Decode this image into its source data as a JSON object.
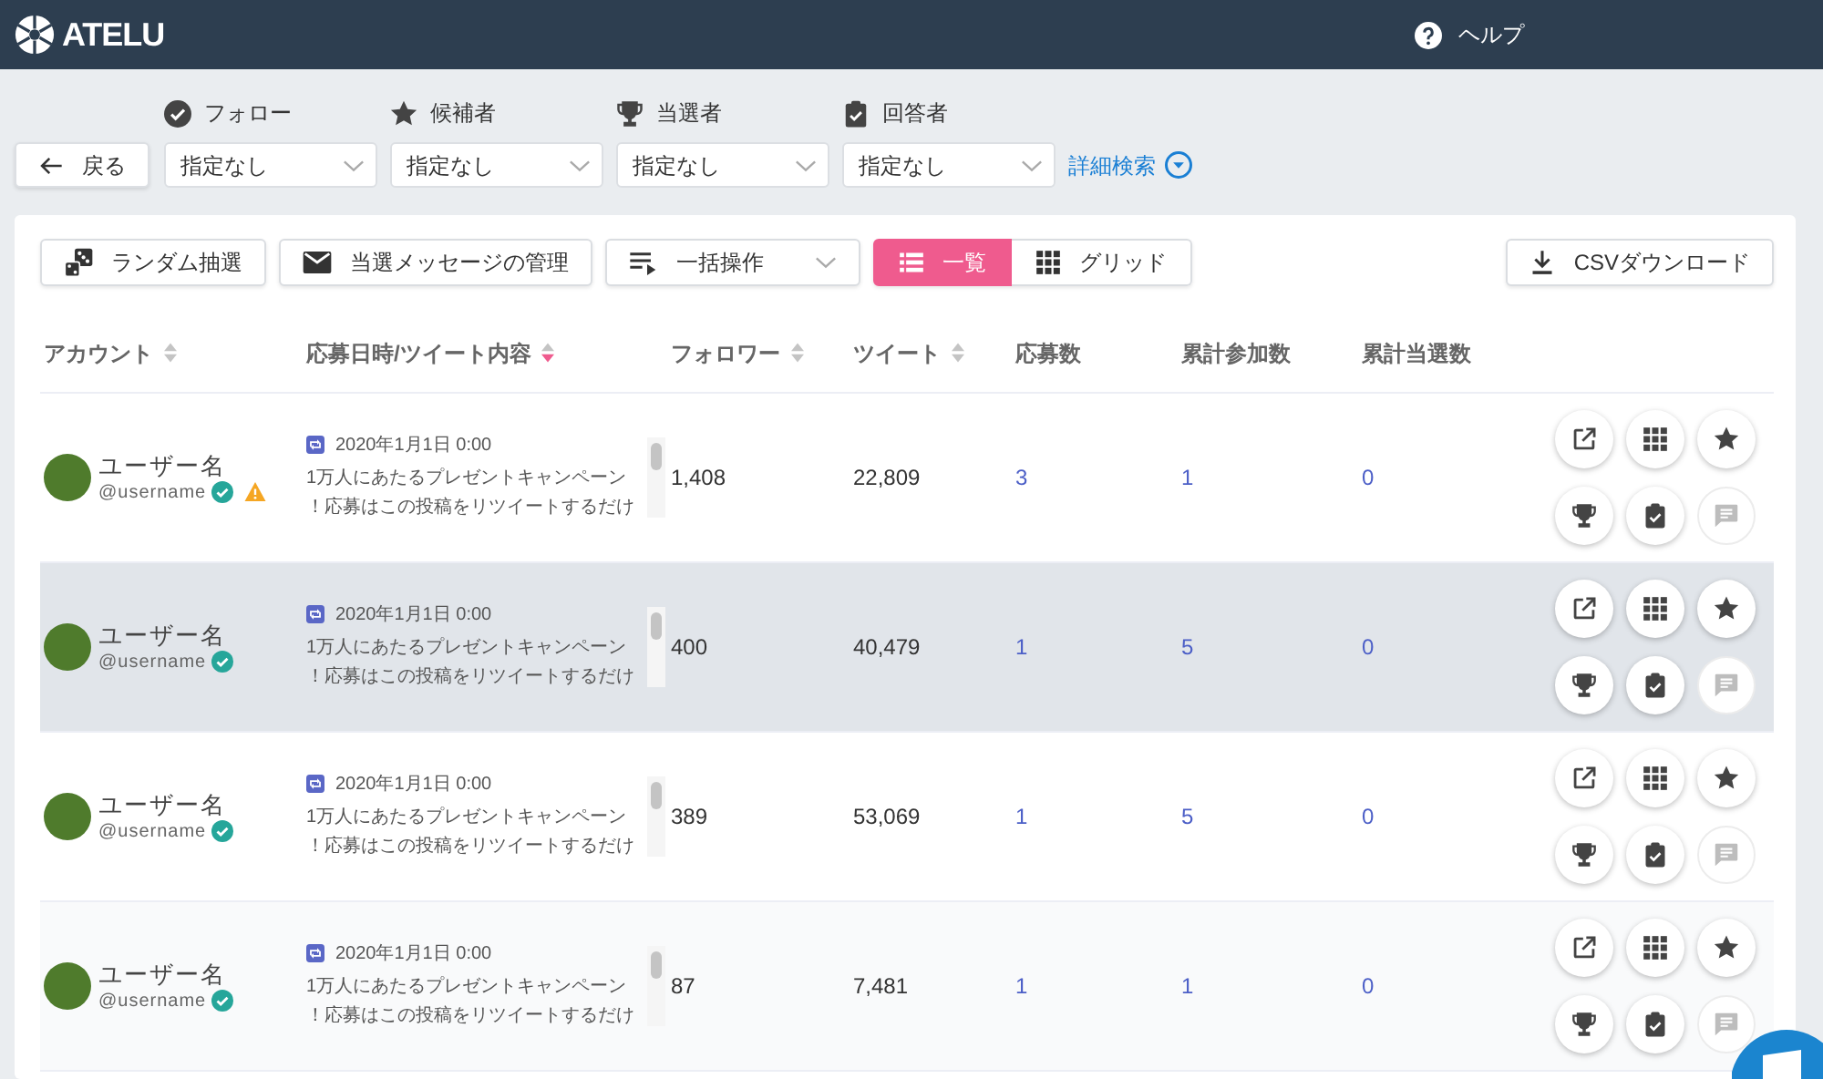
{
  "header": {
    "logo": "ATELU",
    "help": "ヘルプ"
  },
  "back_button": "戻る",
  "filters": [
    {
      "label": "フォロー",
      "value": "指定なし"
    },
    {
      "label": "候補者",
      "value": "指定なし"
    },
    {
      "label": "当選者",
      "value": "指定なし"
    },
    {
      "label": "回答者",
      "value": "指定なし"
    }
  ],
  "advanced_search": "詳細検索",
  "toolbar": {
    "buttons": [
      "ランダム抽選",
      "当選メッセージの管理"
    ],
    "bulk_action": "一括操作",
    "views": [
      {
        "label": "一覧",
        "selected": true
      },
      {
        "label": "グリッド",
        "selected": false
      }
    ],
    "csv_download": "CSVダウンロード"
  },
  "table": {
    "columns": [
      {
        "label": "アカウント",
        "sortable": true,
        "sorted": false
      },
      {
        "label": "応募日時/ツイート内容",
        "sortable": true,
        "sorted": true
      },
      {
        "label": "フォロワー",
        "sortable": true,
        "sorted": false
      },
      {
        "label": "ツイート",
        "sortable": true,
        "sorted": false
      },
      {
        "label": "応募数",
        "sortable": false,
        "sorted": false
      },
      {
        "label": "累計参加数",
        "sortable": false,
        "sorted": false
      },
      {
        "label": "累計当選数",
        "sortable": false,
        "sorted": false
      }
    ],
    "rows": [
      {
        "name": "ユーザー名",
        "username": "@username",
        "verified": true,
        "warning": true,
        "date": "2020年1月1日 0:00",
        "tweet": "1万人にあたるプレゼントキャンペーン！応募はこの投稿をリツイートするだけ",
        "followers": "1,408",
        "tweets": "22,809",
        "applications": "3",
        "total_entries": "1",
        "total_wins": "0",
        "highlighted": false,
        "comment_disabled": true
      },
      {
        "name": "ユーザー名",
        "username": "@username",
        "verified": true,
        "warning": false,
        "date": "2020年1月1日 0:00",
        "tweet": "1万人にあたるプレゼントキャンペーン！応募はこの投稿をリツイートするだけ",
        "followers": "400",
        "tweets": "40,479",
        "applications": "1",
        "total_entries": "5",
        "total_wins": "0",
        "highlighted": true,
        "comment_disabled": true
      },
      {
        "name": "ユーザー名",
        "username": "@username",
        "verified": true,
        "warning": false,
        "date": "2020年1月1日 0:00",
        "tweet": "1万人にあたるプレゼントキャンペーン！応募はこの投稿をリツイートするだけ",
        "followers": "389",
        "tweets": "53,069",
        "applications": "1",
        "total_entries": "5",
        "total_wins": "0",
        "highlighted": false,
        "comment_disabled": true
      },
      {
        "name": "ユーザー名",
        "username": "@username",
        "verified": true,
        "warning": false,
        "date": "2020年1月1日 0:00",
        "tweet": "1万人にあたるプレゼントキャンペーン！応募はこの投稿をリツイートするだけ",
        "followers": "87",
        "tweets": "7,481",
        "applications": "1",
        "total_entries": "1",
        "total_wins": "0",
        "highlighted": false,
        "comment_disabled": true
      }
    ]
  }
}
